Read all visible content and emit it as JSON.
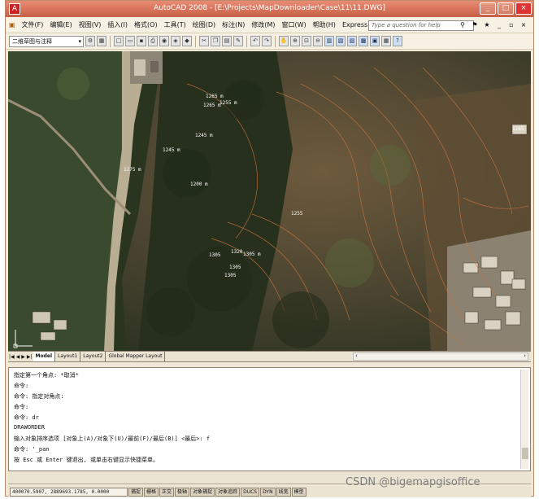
{
  "app": {
    "title": "AutoCAD 2008 - [E:\\Projects\\MapDownloader\\Case\\11\\11.DWG]"
  },
  "window_controls": {
    "minimize": "_",
    "maximize": "□",
    "close": "×"
  },
  "menu": {
    "items": [
      "文件(F)",
      "编辑(E)",
      "视图(V)",
      "插入(I)",
      "格式(O)",
      "工具(T)",
      "绘图(D)",
      "标注(N)",
      "修改(M)",
      "窗口(W)",
      "帮助(H)",
      "Express"
    ]
  },
  "help": {
    "placeholder": "Type a question for help"
  },
  "toolbar": {
    "workspace": "二维草图与注释"
  },
  "map_labels": [
    {
      "text": "1265 m"
    },
    {
      "text": "1265 m"
    },
    {
      "text": "1255 m"
    },
    {
      "text": "1245 m"
    },
    {
      "text": "1245 m"
    },
    {
      "text": "1275 m"
    },
    {
      "text": "1265"
    },
    {
      "text": "1200 m"
    },
    {
      "text": "1305"
    },
    {
      "text": "1320"
    },
    {
      "text": "1305 m"
    },
    {
      "text": "1305"
    },
    {
      "text": "1305"
    },
    {
      "text": "1255"
    }
  ],
  "tabs": {
    "items": [
      "Model",
      "Layout1",
      "Layout2",
      "Global Mapper Layout"
    ],
    "active": "Model"
  },
  "command": {
    "lines": [
      "指定第一个角点: *取消*",
      "命令:",
      "命令: 指定对角点:",
      "命令:",
      "命令: dr",
      "DRAWORDER",
      "输入对象排序选项 [对象上(A)/对象下(U)/最前(F)/最后(B)] <最后>: f",
      "命令: '_pan",
      "按 Esc 或 Enter 键退出, 或单击右键显示快捷菜单。"
    ]
  },
  "status": {
    "coords": "400070.5907, 2889693.1785, 0.0000",
    "buttons": [
      "捕捉",
      "栅格",
      "正交",
      "极轴",
      "对象捕捉",
      "对象追踪",
      "DUCS",
      "DYN",
      "线宽",
      "模型"
    ]
  },
  "watermark": "CSDN @bigemapgisoffice",
  "colors": {
    "titlebar": "#d36f55",
    "map_dark": "#2f3a22",
    "map_brown": "#6b5236",
    "contour": "#c9743d"
  }
}
